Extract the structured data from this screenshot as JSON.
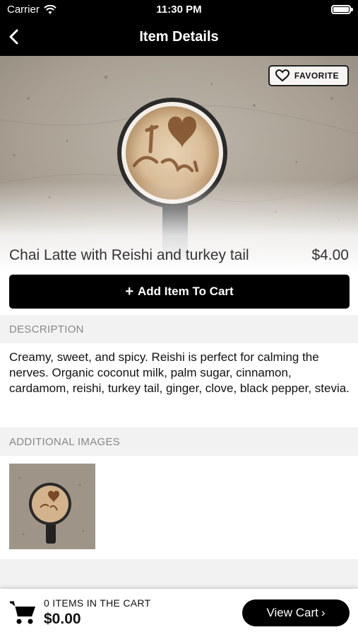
{
  "status_bar": {
    "carrier": "Carrier",
    "time": "11:30 PM"
  },
  "nav": {
    "title": "Item Details"
  },
  "hero": {
    "favorite_label": "FAVORITE"
  },
  "item": {
    "name": "Chai Latte with Reishi and turkey tail",
    "price": "$4.00",
    "add_label": "Add Item To Cart"
  },
  "description": {
    "heading": "DESCRIPTION",
    "text": "Creamy, sweet, and spicy. Reishi is perfect for calming the nerves. Organic coconut milk, palm sugar, cinnamon, cardamom, reishi, turkey tail, ginger, clove, black pepper, stevia."
  },
  "additional_images": {
    "heading": "ADDITIONAL IMAGES"
  },
  "cart": {
    "count_label": "0 ITEMS IN THE CART",
    "total": "$0.00",
    "view_label": "View Cart",
    "view_chevron": "›"
  },
  "icons": [
    "wifi-icon",
    "back-chevron-icon",
    "heart-icon",
    "plus-icon",
    "shopping-cart-icon"
  ]
}
